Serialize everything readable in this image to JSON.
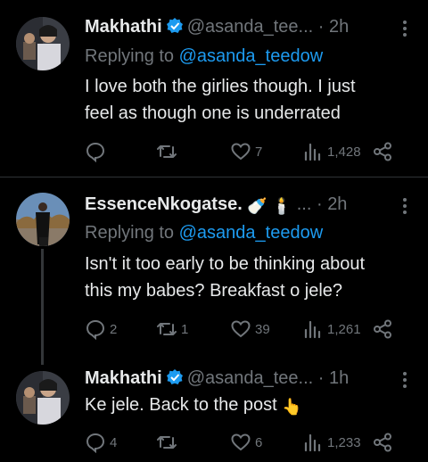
{
  "tweets": [
    {
      "name": "Makhathi",
      "handle": "@asanda_tee...",
      "dot": "·",
      "time": "2h",
      "reply_prefix": "Replying to",
      "reply_to": "@asanda_teedow",
      "body_line1": "I love both the girlies though. I just",
      "body_line2": "feel as though one is underrated",
      "replies": "",
      "retweets": "",
      "likes": "7",
      "views": "1,428"
    },
    {
      "name": "EssenceNkogatse.",
      "name_emoji": "🍼 🕯️",
      "handle": "...",
      "dot": "·",
      "time": "2h",
      "reply_prefix": "Replying to",
      "reply_to": "@asanda_teedow",
      "body_line1": "Isn't it too early to be thinking about",
      "body_line2": "this my babes? Breakfast o jele?",
      "replies": "2",
      "retweets": "1",
      "likes": "39",
      "views": "1,261"
    },
    {
      "name": "Makhathi",
      "handle": "@asanda_tee...",
      "dot": "·",
      "time": "1h",
      "body_line1": "Ke jele. Back to the post",
      "body_emoji": "👆",
      "replies": "4",
      "retweets": "",
      "likes": "6",
      "views": "1,233"
    }
  ],
  "colors": {
    "background": "#000000",
    "text": "#e7e9ea",
    "muted": "#71767b",
    "link": "#1d9bf0",
    "verified": "#1d9bf0",
    "divider": "#2f3336"
  },
  "icons": [
    "verified-badge-icon",
    "more-icon",
    "reply-icon",
    "retweet-icon",
    "like-icon",
    "views-icon",
    "share-icon"
  ]
}
